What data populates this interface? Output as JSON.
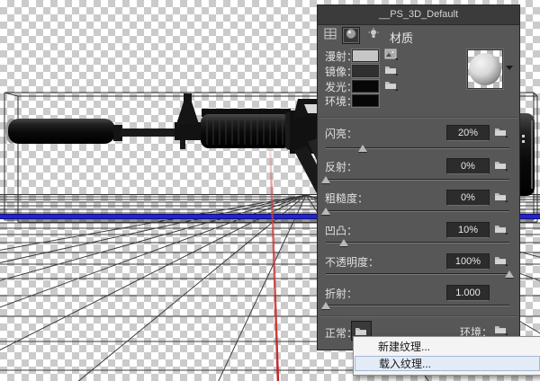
{
  "window": {
    "title": "__PS_3D_Default"
  },
  "panel": {
    "tab_label": "材质",
    "filters": [
      {
        "icon": "scene-filter-icon",
        "selected": false
      },
      {
        "icon": "materials-filter-icon",
        "selected": true
      },
      {
        "icon": "lights-filter-icon",
        "selected": false
      }
    ],
    "channels": [
      {
        "label": "漫射：",
        "swatch": "#c6c6c6",
        "icon": "texture-image-icon"
      },
      {
        "label": "镜像：",
        "swatch": "#303030",
        "icon": "folder-icon"
      },
      {
        "label": "发光：",
        "swatch": "#070707",
        "icon": "folder-icon"
      },
      {
        "label": "环境：",
        "swatch": "#060606",
        "icon": null
      }
    ],
    "sliders": [
      {
        "label": "闪亮：",
        "value": "20%",
        "percent": 20
      },
      {
        "label": "反射：",
        "value": "0%",
        "percent": 0
      },
      {
        "label": "粗糙度：",
        "value": "0%",
        "percent": 0
      },
      {
        "label": "凹凸：",
        "value": "10%",
        "percent": 10
      },
      {
        "label": "不透明度：",
        "value": "100%",
        "percent": 100
      },
      {
        "label": "折射：",
        "value": "1.000",
        "percent": 0
      }
    ],
    "normal_label": "正常：",
    "environment_label": "环境："
  },
  "context_menu": {
    "items": [
      {
        "label": "新建纹理...",
        "selected": false
      },
      {
        "label": "载入纹理...",
        "selected": true
      }
    ]
  },
  "colors": {
    "ground_line": "#2424cc",
    "laser": "#cc2020",
    "menu_highlight": "#e3ebf6",
    "panel_bg": "#575757"
  }
}
